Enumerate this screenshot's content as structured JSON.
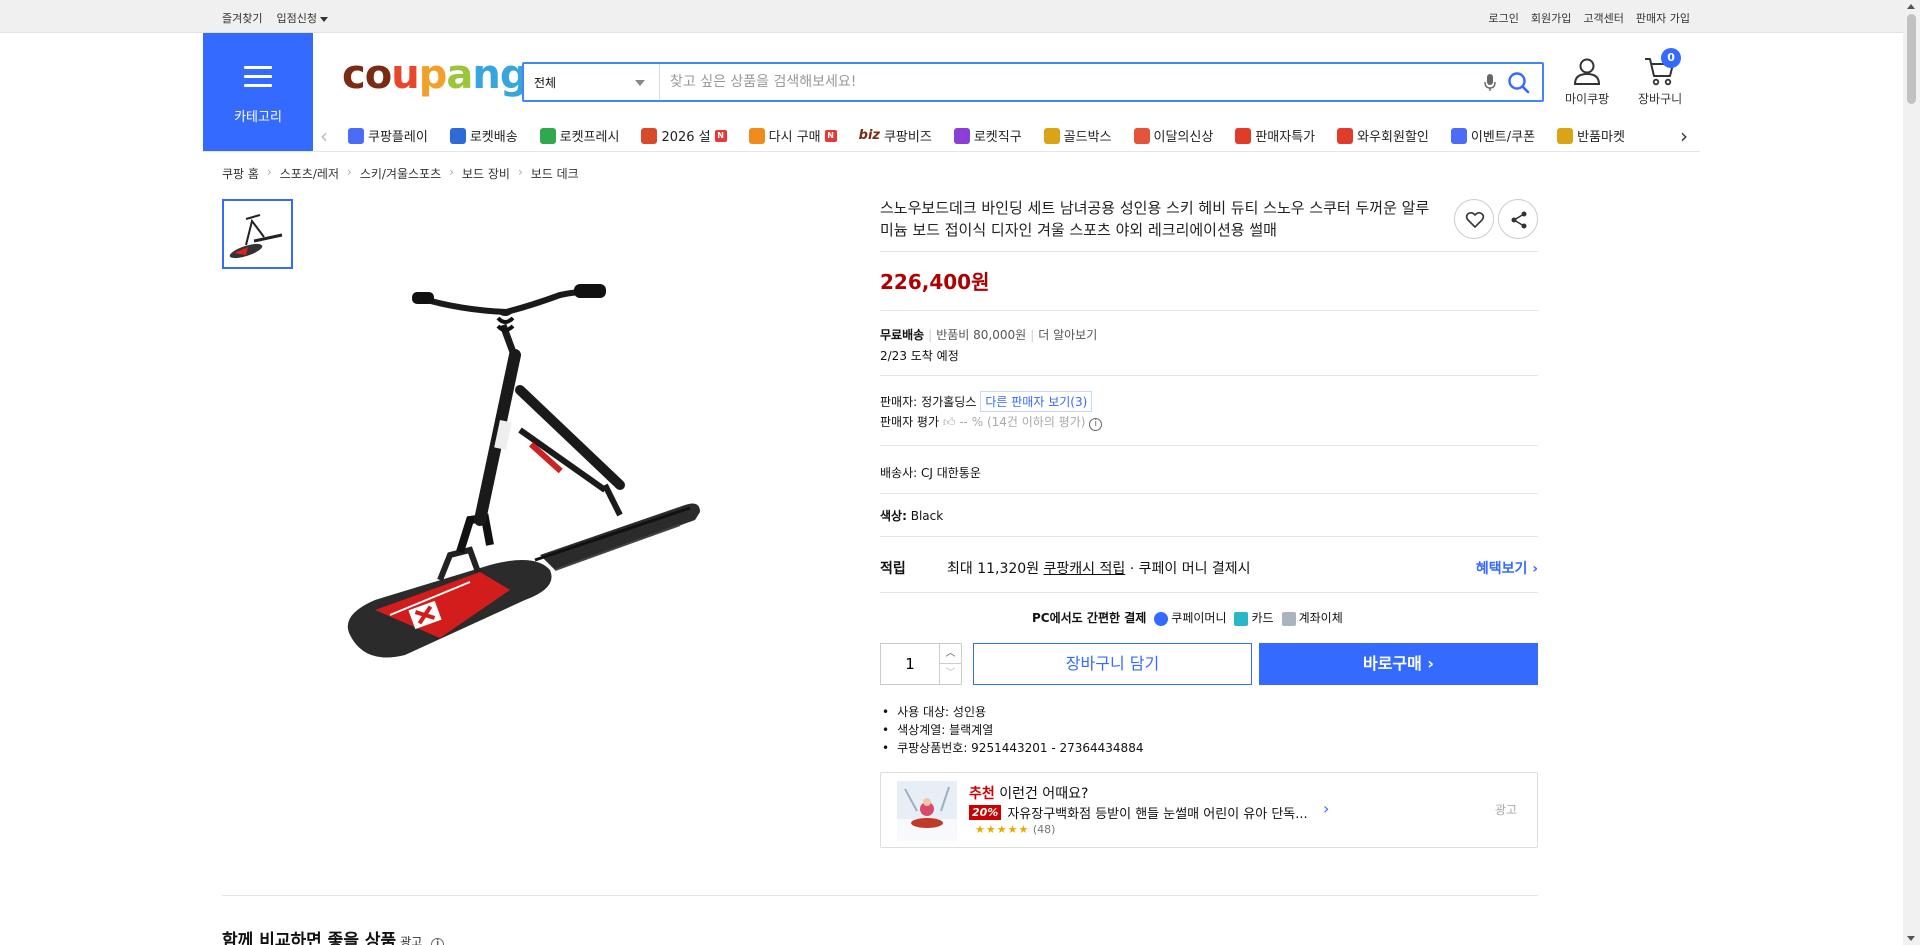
{
  "topbar": {
    "left": [
      "즐겨찾기",
      "입점신청"
    ],
    "right": [
      "로그인",
      "회원가입",
      "고객센터",
      "판매자 가입"
    ]
  },
  "header": {
    "category_label": "카테고리",
    "logo_letters": [
      "c",
      "o",
      "u",
      "p",
      "a",
      "n",
      "g"
    ],
    "logo_colors": [
      "#7b2b14",
      "#7b2b14",
      "#e8472a",
      "#f3a02a",
      "#9bc53d",
      "#37a6de",
      "#37a6de"
    ],
    "search_select": "전체",
    "search_placeholder": "찾고 싶은 상품을 검색해보세요!",
    "mycoupang_label": "마이쿠팡",
    "cart_label": "장바구니",
    "cart_count": "0"
  },
  "nav": {
    "items": [
      {
        "label": "쿠팡플레이",
        "icon": "play-icon",
        "color": "#4a6cf7",
        "new": false
      },
      {
        "label": "로켓배송",
        "icon": "rocket-icon",
        "color": "#2d6ad6",
        "new": false
      },
      {
        "label": "로켓프레시",
        "icon": "rocket-fresh-icon",
        "color": "#2fa84f",
        "new": false
      },
      {
        "label": "2026 설",
        "icon": "gift-icon",
        "color": "#d84a2a",
        "new": true
      },
      {
        "label": "다시 구매",
        "icon": "repurchase-icon",
        "color": "#f28b1e",
        "new": true
      },
      {
        "label": "쿠팡비즈",
        "prefix": "biz",
        "icon": "biz-icon",
        "color": "#7b2b14",
        "new": false
      },
      {
        "label": "로켓직구",
        "icon": "global-icon",
        "color": "#8b3fd6",
        "new": false
      },
      {
        "label": "골드박스",
        "icon": "goldbox-icon",
        "color": "#d9a516",
        "new": false
      },
      {
        "label": "이달의신상",
        "icon": "new-bag-icon",
        "color": "#e5533a",
        "new": false
      },
      {
        "label": "판매자특가",
        "icon": "percent-icon",
        "color": "#e33b2a",
        "new": false
      },
      {
        "label": "와우회원할인",
        "icon": "wow-icon",
        "color": "#e33b2a",
        "new": false
      },
      {
        "label": "이벤트/쿠폰",
        "icon": "coupon-icon",
        "color": "#4a6cf7",
        "new": false
      },
      {
        "label": "반품마켓",
        "icon": "market-icon",
        "color": "#d9a516",
        "new": false
      }
    ],
    "new_badge": "N"
  },
  "breadcrumb": [
    "쿠팡 홈",
    "스포츠/레저",
    "스키/겨울스포츠",
    "보드 장비",
    "보드 데크"
  ],
  "product": {
    "title": "스노우보드데크 바인딩 세트 남녀공용 성인용 스키 헤비 듀티 스노우 스쿠터 두꺼운 알루미늄 보드 접이식 디자인 겨울 스포츠 야외 레크리에이션용 썰매",
    "price": "226,400원",
    "shipping_free": "무료배송",
    "return_fee": "반품비 80,000원",
    "learn_more": "더 알아보기",
    "arrival": "2/23 도착 예정",
    "seller_label": "판매자:",
    "seller_name": "정가홀딩스",
    "other_sellers": "다른 판매자 보기(3)",
    "seller_rating_label": "판매자 평가",
    "seller_rating_value": "-- %",
    "seller_rating_note": "(14건 이하의 평가)",
    "courier": "배송사:  CJ 대한통운",
    "color_label": "색상:",
    "color_value": "Black",
    "reward_label": "적립",
    "reward_text_prefix": "최대 11,320원",
    "reward_link": "쿠팡캐시 적립",
    "reward_text_suffix": "· 쿠페이 머니 결제시",
    "reward_more": "혜택보기",
    "pc_pay_label": "PC에서도 간편한 결제",
    "pay_methods": [
      "쿠페이머니",
      "카드",
      "계좌이체"
    ],
    "quantity": "1",
    "add_to_cart": "장바구니 담기",
    "buy_now": "바로구매",
    "specs": [
      "사용 대상: 성인용",
      "색상계열: 블랙계열",
      "쿠팡상품번호: 9251443201 - 27364434884"
    ]
  },
  "recommendation": {
    "tag": "추천",
    "heading": "이런건 어때요?",
    "discount": "20%",
    "name": "자유장구백화점 등받이 핸들 눈썰매 어린이 유아 단독...",
    "stars": "★★★★★",
    "reviews": "(48)",
    "ad_label": "광고"
  },
  "section": {
    "compare_title": "함께 비교하면 좋을 상품",
    "compare_ad": "광고"
  }
}
